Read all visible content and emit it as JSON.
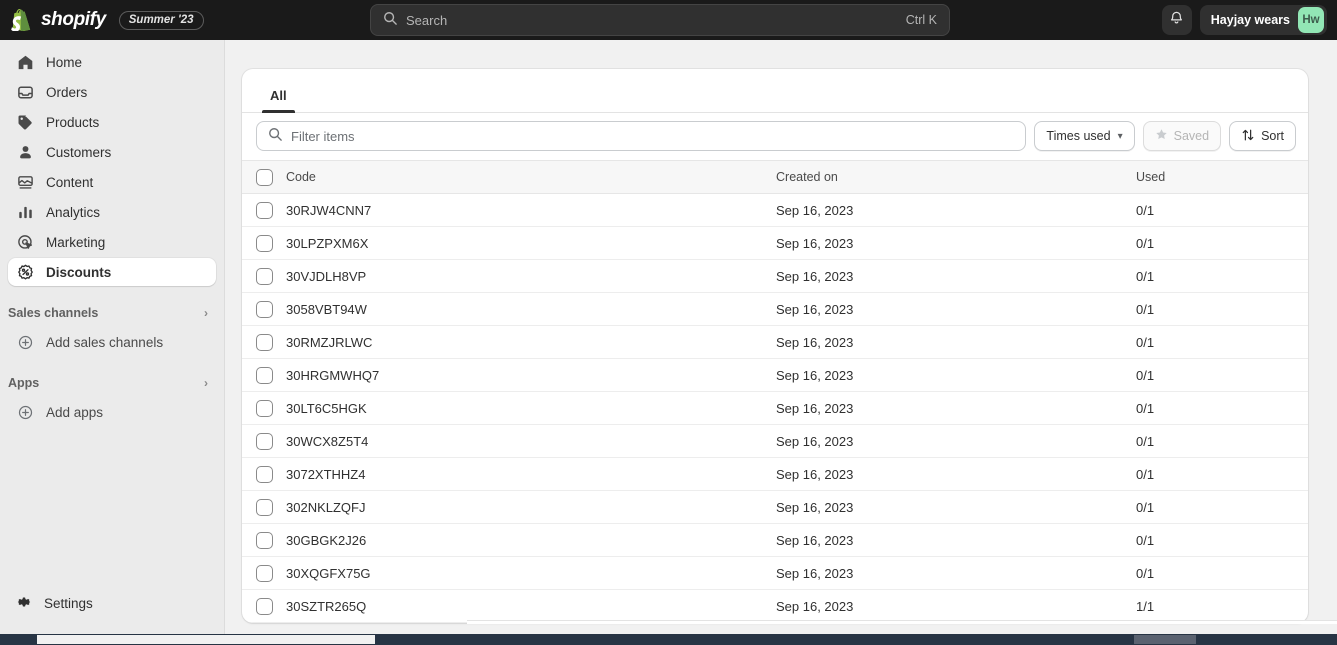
{
  "topbar": {
    "logo_text": "shopify",
    "logo_icon": "shopify-bag-icon",
    "season_badge": "Summer '23",
    "search": {
      "placeholder": "Search",
      "shortcut": "Ctrl K",
      "icon": "search-icon"
    },
    "notifications_icon": "bell-icon",
    "account": {
      "name": "Hayjay wears",
      "avatar_initials": "Hw",
      "avatar_color": "#92e6b5"
    }
  },
  "sidebar": {
    "items": [
      {
        "label": "Home",
        "icon": "home-icon",
        "active": false
      },
      {
        "label": "Orders",
        "icon": "orders-inbox-icon",
        "active": false
      },
      {
        "label": "Products",
        "icon": "products-tag-icon",
        "active": false
      },
      {
        "label": "Customers",
        "icon": "customers-person-icon",
        "active": false
      },
      {
        "label": "Content",
        "icon": "content-image-icon",
        "active": false
      },
      {
        "label": "Analytics",
        "icon": "analytics-bars-icon",
        "active": false
      },
      {
        "label": "Marketing",
        "icon": "marketing-target-icon",
        "active": false
      },
      {
        "label": "Discounts",
        "icon": "discounts-percent-icon",
        "active": true
      }
    ],
    "sections": [
      {
        "title": "Sales channels",
        "chevron_icon": "chevron-right-icon",
        "action_label": "Add sales channels",
        "action_icon": "plus-circle-icon"
      },
      {
        "title": "Apps",
        "chevron_icon": "chevron-right-icon",
        "action_label": "Add apps",
        "action_icon": "plus-circle-icon"
      }
    ],
    "settings": {
      "label": "Settings",
      "icon": "gear-icon"
    }
  },
  "main": {
    "tabs": [
      {
        "label": "All",
        "active": true
      }
    ],
    "filter": {
      "placeholder": "Filter items",
      "icon": "search-icon"
    },
    "controls": {
      "times_used_label": "Times used",
      "times_used_chevron": "chevron-down-icon",
      "saved_label": "Saved",
      "saved_icon": "star-icon",
      "saved_disabled": true,
      "sort_label": "Sort",
      "sort_icon": "sort-arrows-icon"
    },
    "table": {
      "select_all_checkbox": "checkbox-unchecked",
      "columns": [
        "Code",
        "Created on",
        "Used"
      ],
      "rows": [
        {
          "code": "30RJW4CNN7",
          "created_on": "Sep 16, 2023",
          "used": "0/1"
        },
        {
          "code": "30LPZPXM6X",
          "created_on": "Sep 16, 2023",
          "used": "0/1"
        },
        {
          "code": "30VJDLH8VP",
          "created_on": "Sep 16, 2023",
          "used": "0/1"
        },
        {
          "code": "3058VBT94W",
          "created_on": "Sep 16, 2023",
          "used": "0/1"
        },
        {
          "code": "30RMZJRLWC",
          "created_on": "Sep 16, 2023",
          "used": "0/1"
        },
        {
          "code": "30HRGMWHQ7",
          "created_on": "Sep 16, 2023",
          "used": "0/1"
        },
        {
          "code": "30LT6C5HGK",
          "created_on": "Sep 16, 2023",
          "used": "0/1"
        },
        {
          "code": "30WCX8Z5T4",
          "created_on": "Sep 16, 2023",
          "used": "0/1"
        },
        {
          "code": "3072XTHHZ4",
          "created_on": "Sep 16, 2023",
          "used": "0/1"
        },
        {
          "code": "302NKLZQFJ",
          "created_on": "Sep 16, 2023",
          "used": "0/1"
        },
        {
          "code": "30GBGK2J26",
          "created_on": "Sep 16, 2023",
          "used": "0/1"
        },
        {
          "code": "30XQGFX75G",
          "created_on": "Sep 16, 2023",
          "used": "0/1"
        },
        {
          "code": "30SZTR265Q",
          "created_on": "Sep 16, 2023",
          "used": "1/1"
        }
      ]
    }
  }
}
